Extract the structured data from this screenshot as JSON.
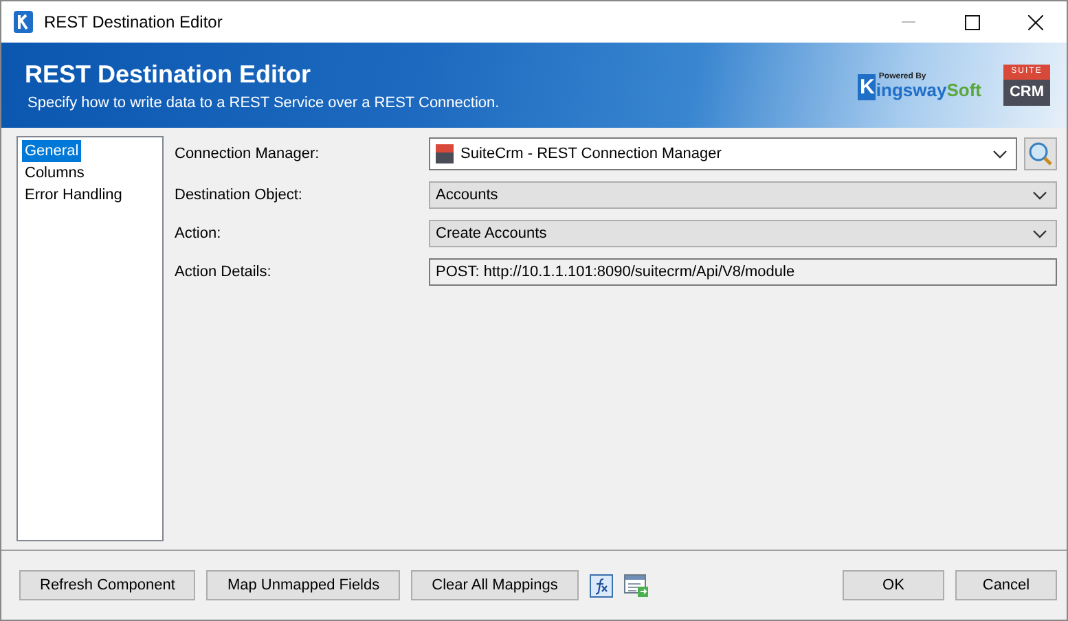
{
  "window": {
    "title": "REST Destination Editor"
  },
  "header": {
    "title": "REST Destination Editor",
    "subtitle": "Specify how to write data to a REST Service over a REST Connection.",
    "powered_by": "Powered By",
    "brand_first": "K",
    "brand_rest": "ingsway",
    "brand_end": "Soft",
    "crm_top": "SUITE",
    "crm_bottom": "CRM"
  },
  "sidebar": {
    "items": [
      {
        "label": "General",
        "selected": true
      },
      {
        "label": "Columns",
        "selected": false
      },
      {
        "label": "Error Handling",
        "selected": false
      }
    ]
  },
  "form": [
    {
      "kind": "combo",
      "label": "Connection Manager:",
      "value": "SuiteCrm - REST Connection Manager"
    },
    {
      "kind": "dropdown",
      "label": "Destination Object:",
      "value": "Accounts"
    },
    {
      "kind": "dropdown",
      "label": "Action:",
      "value": "Create Accounts"
    },
    {
      "kind": "readonly",
      "label": "Action Details:",
      "value": "POST: http://10.1.1.101:8090/suitecrm/Api/V8/module"
    }
  ],
  "buttons_left": [
    "Refresh Component",
    "Map Unmapped Fields",
    "Clear All Mappings"
  ],
  "buttons_right": [
    "OK",
    "Cancel"
  ]
}
